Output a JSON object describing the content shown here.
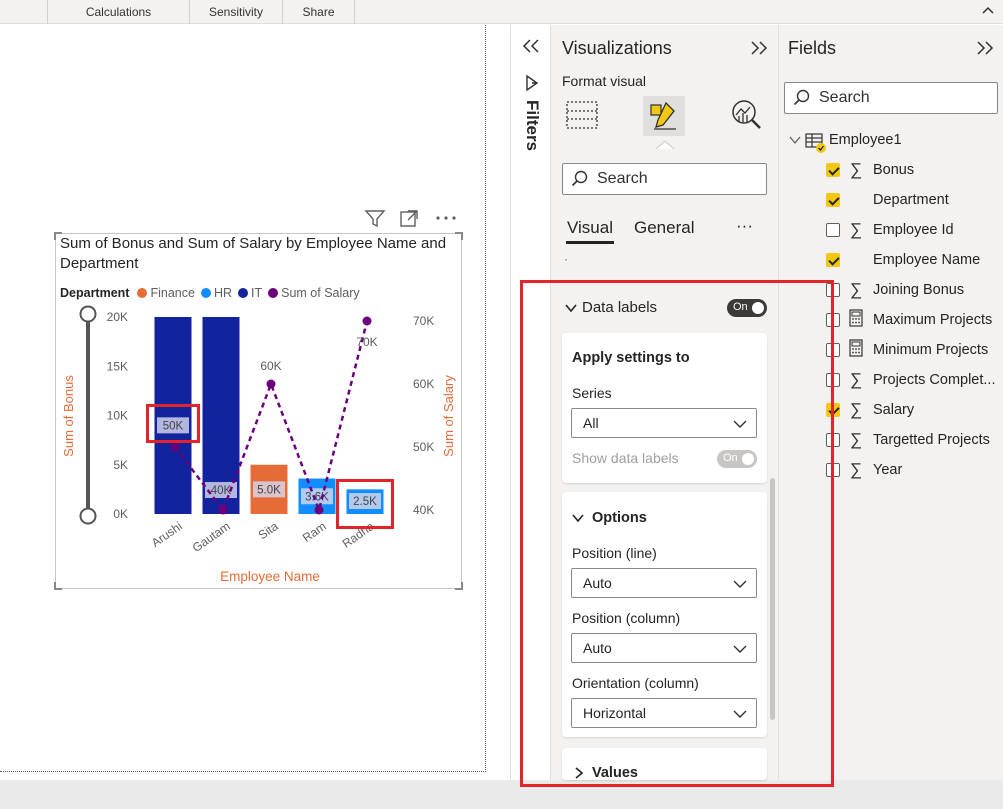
{
  "ribbon": {
    "tabs": [
      "Calculations",
      "Sensitivity",
      "Share"
    ]
  },
  "chart": {
    "title": "Sum of Bonus and Sum of Salary by Employee Name and Department",
    "legend_title": "Department",
    "legend_items": [
      {
        "label": "Finance",
        "color": "#e66c37"
      },
      {
        "label": "HR",
        "color": "#118dff"
      },
      {
        "label": "IT",
        "color": "#12239e"
      },
      {
        "label": "Sum of Salary",
        "color": "#6b007b"
      }
    ],
    "xlabel": "Employee Name",
    "ylabel_left": "Sum of Bonus",
    "ylabel_right": "Sum of Salary"
  },
  "chart_data": {
    "type": "bar",
    "title": "Sum of Bonus and Sum of Salary by Employee Name and Department",
    "categories": [
      "Arushi",
      "Gautam",
      "Sita",
      "Ram",
      "Radha"
    ],
    "left_ticks": [
      "20K",
      "15K",
      "10K",
      "5K",
      "0K"
    ],
    "right_ticks": [
      "70K",
      "60K",
      "50K",
      "40K"
    ],
    "ylim_left": [
      0,
      20000
    ],
    "ylim_right": [
      40000,
      70000
    ],
    "series": [
      {
        "name": "IT",
        "color": "#12239e",
        "values": [
          20000,
          20000,
          null,
          null,
          null
        ]
      },
      {
        "name": "Finance",
        "color": "#e66c37",
        "values": [
          null,
          null,
          5000,
          null,
          null
        ]
      },
      {
        "name": "HR",
        "color": "#118dff",
        "values": [
          null,
          null,
          null,
          3600,
          2500
        ]
      },
      {
        "name": "Sum of Salary",
        "color": "#6b007b",
        "type": "line",
        "values": [
          50000,
          40000,
          60000,
          40000,
          70000
        ]
      }
    ],
    "bar_labels": [
      "50K",
      "40K",
      "5.0K",
      "3.6K",
      "2.5K"
    ],
    "line_labels": [
      "",
      "",
      "60K",
      "",
      "70K"
    ],
    "xlabel": "Employee Name",
    "ylabel": "Sum of Bonus",
    "y2label": "Sum of Salary",
    "legend_placement": "top-left"
  },
  "viz": {
    "title": "Visualizations",
    "subtitle": "Format visual",
    "search_placeholder": "Search",
    "tab_visual": "Visual",
    "tab_general": "General",
    "more": "···",
    "dot": "·",
    "data_labels": "Data labels",
    "data_labels_toggle": "On",
    "apply_settings": "Apply settings to",
    "series_label": "Series",
    "series_value": "All",
    "show_data_labels": "Show data labels",
    "show_data_labels_toggle": "On",
    "options": "Options",
    "position_line_label": "Position (line)",
    "position_line_value": "Auto",
    "position_column_label": "Position (column)",
    "position_column_value": "Auto",
    "orientation_label": "Orientation (column)",
    "orientation_value": "Horizontal",
    "values": "Values"
  },
  "filters": {
    "label": "Filters"
  },
  "fields": {
    "title": "Fields",
    "search_placeholder": "Search",
    "table_name": "Employee1",
    "items": [
      {
        "label": "Bonus",
        "checked": true,
        "icon": "sigma"
      },
      {
        "label": "Department",
        "checked": true,
        "icon": "none"
      },
      {
        "label": "Employee Id",
        "checked": false,
        "icon": "sigma"
      },
      {
        "label": "Employee Name",
        "checked": true,
        "icon": "none"
      },
      {
        "label": "Joining Bonus",
        "checked": false,
        "icon": "sigma"
      },
      {
        "label": "Maximum Projects",
        "checked": false,
        "icon": "calculator"
      },
      {
        "label": "Minimum Projects",
        "checked": false,
        "icon": "calculator"
      },
      {
        "label": "Projects Complet...",
        "checked": false,
        "icon": "sigma"
      },
      {
        "label": "Salary",
        "checked": true,
        "icon": "sigma"
      },
      {
        "label": "Targetted Projects",
        "checked": false,
        "icon": "sigma"
      },
      {
        "label": "Year",
        "checked": false,
        "icon": "sigma"
      }
    ]
  }
}
